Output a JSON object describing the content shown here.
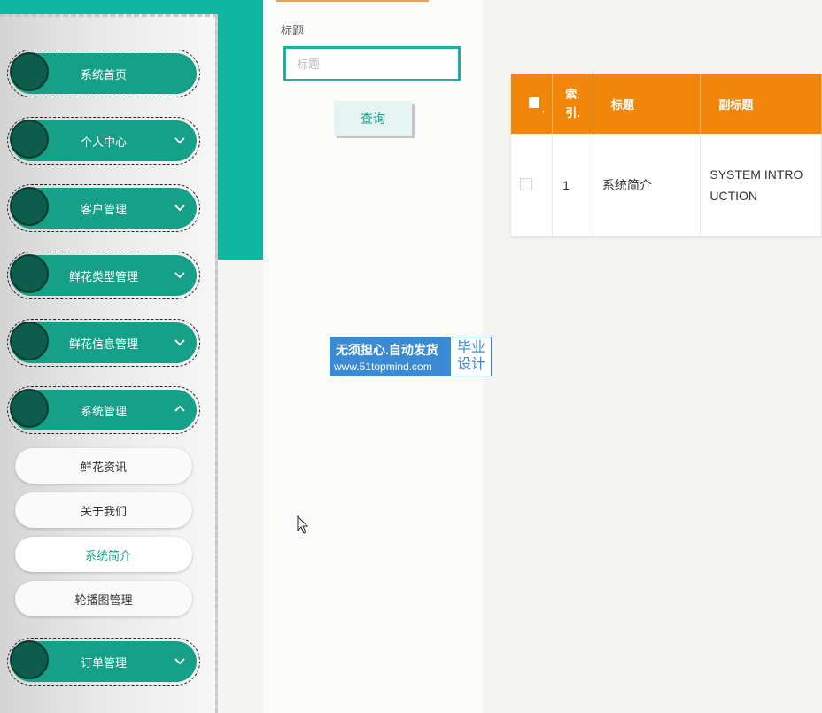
{
  "sidebar": {
    "menu": [
      {
        "label": "系统首页",
        "chevron": "none"
      },
      {
        "label": "个人中心",
        "chevron": "down"
      },
      {
        "label": "客户管理",
        "chevron": "down"
      },
      {
        "label": "鲜花类型管理",
        "chevron": "down"
      },
      {
        "label": "鲜花信息管理",
        "chevron": "down"
      },
      {
        "label": "系统管理",
        "chevron": "up"
      },
      {
        "label": "订单管理",
        "chevron": "down"
      }
    ],
    "submenu": [
      {
        "label": "鲜花资讯",
        "active": false
      },
      {
        "label": "关于我们",
        "active": false
      },
      {
        "label": "系统简介",
        "active": true
      },
      {
        "label": "轮播图管理",
        "active": false
      }
    ]
  },
  "search": {
    "label": "标题",
    "input_value": "",
    "placeholder": "标题",
    "button_label": "查询"
  },
  "table": {
    "headers": [
      "",
      "索引",
      "标题",
      "副标题"
    ],
    "index_header_lines": [
      "索.",
      "引."
    ],
    "rows": [
      {
        "index": "1",
        "title": "系统简介",
        "subtitle": "SYSTEM INTRODUCTION"
      }
    ],
    "subtitle_visible_lines": [
      "SYSTEM INTRO",
      "UCTION"
    ]
  },
  "watermark": {
    "line1": "无须担心.自动发货",
    "line2": "www.51topmind.com",
    "right1": "毕业",
    "right2": "设计"
  },
  "colors": {
    "teal": "#10b5a0",
    "menu_pill": "#17a088",
    "table_header": "#f0870a",
    "watermark": "#3a8bd4"
  }
}
